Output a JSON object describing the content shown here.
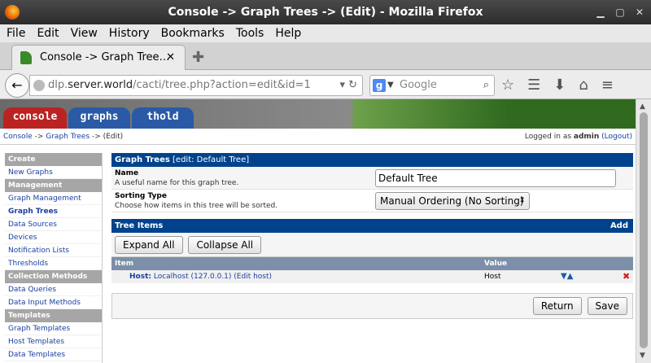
{
  "window": {
    "title": "Console -> Graph Trees -> (Edit) - Mozilla Firefox"
  },
  "menubar": [
    "File",
    "Edit",
    "View",
    "History",
    "Bookmarks",
    "Tools",
    "Help"
  ],
  "tab": {
    "title": "Console -> Graph Tree…",
    "close": "✕"
  },
  "url": {
    "prefix": "dlp.",
    "host": "server.world",
    "path": "/cacti/tree.php?action=edit&id=1"
  },
  "search": {
    "placeholder": "Google"
  },
  "cacti_tabs": [
    "console",
    "graphs",
    "thold"
  ],
  "breadcrumb": {
    "console": "Console",
    "sep1": " -> ",
    "graph_trees": "Graph Trees",
    "sep2": " -> (Edit)"
  },
  "login": {
    "prefix": "Logged in as ",
    "user": "admin",
    "logout": "(Logout)"
  },
  "sidebar": [
    {
      "type": "head",
      "label": "Create"
    },
    {
      "type": "item",
      "label": "New Graphs"
    },
    {
      "type": "head",
      "label": "Management"
    },
    {
      "type": "item",
      "label": "Graph Management"
    },
    {
      "type": "item",
      "label": "Graph Trees",
      "active": true
    },
    {
      "type": "item",
      "label": "Data Sources"
    },
    {
      "type": "item",
      "label": "Devices"
    },
    {
      "type": "item",
      "label": "Notification Lists"
    },
    {
      "type": "item",
      "label": "Thresholds"
    },
    {
      "type": "head",
      "label": "Collection Methods"
    },
    {
      "type": "item",
      "label": "Data Queries"
    },
    {
      "type": "item",
      "label": "Data Input Methods"
    },
    {
      "type": "head",
      "label": "Templates"
    },
    {
      "type": "item",
      "label": "Graph Templates"
    },
    {
      "type": "item",
      "label": "Host Templates"
    },
    {
      "type": "item",
      "label": "Data Templates"
    }
  ],
  "form": {
    "header_title": "Graph Trees",
    "header_edit": "[edit: Default Tree]",
    "name_label": "Name",
    "name_desc": "A useful name for this graph tree.",
    "name_value": "Default Tree",
    "sort_label": "Sorting Type",
    "sort_desc": "Choose how items in this tree will be sorted.",
    "sort_value": "Manual Ordering (No Sorting)"
  },
  "tree_items": {
    "header": "Tree Items",
    "add": "Add",
    "expand_all": "Expand All",
    "collapse_all": "Collapse All",
    "col_item": "Item",
    "col_value": "Value",
    "rows": [
      {
        "host_prefix": "Host:",
        "host_text": " Localhost (127.0.0.1) (Edit host)",
        "value": "Host"
      }
    ]
  },
  "actions": {
    "return": "Return",
    "save": "Save"
  }
}
